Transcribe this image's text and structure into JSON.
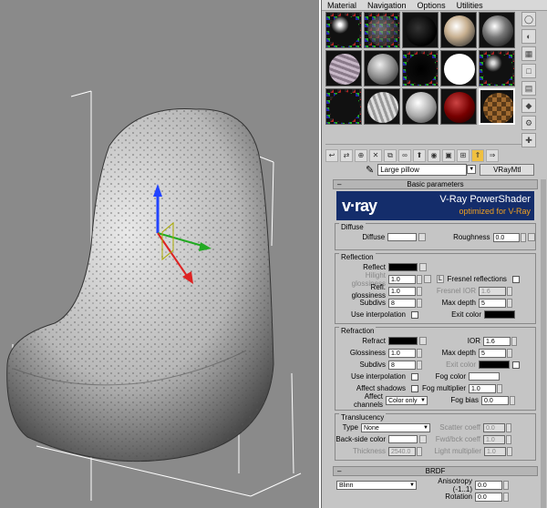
{
  "menubar": [
    "Material",
    "Navigation",
    "Options",
    "Utilities"
  ],
  "material_name": "Large pillow",
  "material_type": "VRayMtl",
  "rollout_basic": "Basic parameters",
  "banner": {
    "logo": "v·ray",
    "title": "V-Ray PowerShader",
    "subtitle": "optimized for V-Ray"
  },
  "diffuse": {
    "group": "Diffuse",
    "diffuse_label": "Diffuse",
    "roughness_label": "Roughness",
    "roughness_value": "0.0",
    "diffuse_color": "#ffffff"
  },
  "reflection": {
    "group": "Reflection",
    "reflect_label": "Reflect",
    "reflect_color": "#000000",
    "hilight_label": "Hilight glossiness",
    "hilight_value": "1.0",
    "lock_label": "L",
    "fresnel_label": "Fresnel reflections",
    "refl_gloss_label": "Refl. glossiness",
    "refl_gloss_value": "1.0",
    "fresnel_ior_label": "Fresnel IOR",
    "fresnel_ior_value": "1.6",
    "subdivs_label": "Subdivs",
    "subdivs_value": "8",
    "maxdepth_label": "Max depth",
    "maxdepth_value": "5",
    "interp_label": "Use interpolation",
    "exit_label": "Exit color",
    "exit_color": "#000000"
  },
  "refraction": {
    "group": "Refraction",
    "refract_label": "Refract",
    "refract_color": "#000000",
    "ior_label": "IOR",
    "ior_value": "1.6",
    "gloss_label": "Glossiness",
    "gloss_value": "1.0",
    "maxdepth_label": "Max depth",
    "maxdepth_value": "5",
    "subdivs_label": "Subdivs",
    "subdivs_value": "8",
    "exit_label": "Exit color",
    "exit_color": "#000000",
    "interp_label": "Use interpolation",
    "fog_color_label": "Fog color",
    "fog_color": "#ffffff",
    "shadows_label": "Affect shadows",
    "fog_mult_label": "Fog multiplier",
    "fog_mult_value": "1.0",
    "channels_label": "Affect channels",
    "channels_value": "Color only",
    "fog_bias_label": "Fog bias",
    "fog_bias_value": "0.0"
  },
  "translucency": {
    "group": "Translucency",
    "type_label": "Type",
    "type_value": "None",
    "scatter_label": "Scatter coeff",
    "scatter_value": "0.0",
    "backside_label": "Back-side color",
    "backside_color": "#ffffff",
    "fwdbck_label": "Fwd/bck coeff",
    "fwdbck_value": "1.0",
    "thickness_label": "Thickness",
    "thickness_value": "2540.0",
    "light_mult_label": "Light multiplier",
    "light_mult_value": "1.0"
  },
  "rollout_brdf": "BRDF",
  "brdf": {
    "type_value": "Blinn",
    "anisotropy_label": "Anisotropy (-1..1)",
    "anisotropy_value": "0.0",
    "rotation_label": "Rotation",
    "rotation_value": "0.0"
  },
  "icons": [
    "sphere-type",
    "backlight",
    "background-checker",
    "sample-uv",
    "video-check",
    "make-preview",
    "options",
    "select-by-material",
    "material-map-navigator"
  ]
}
